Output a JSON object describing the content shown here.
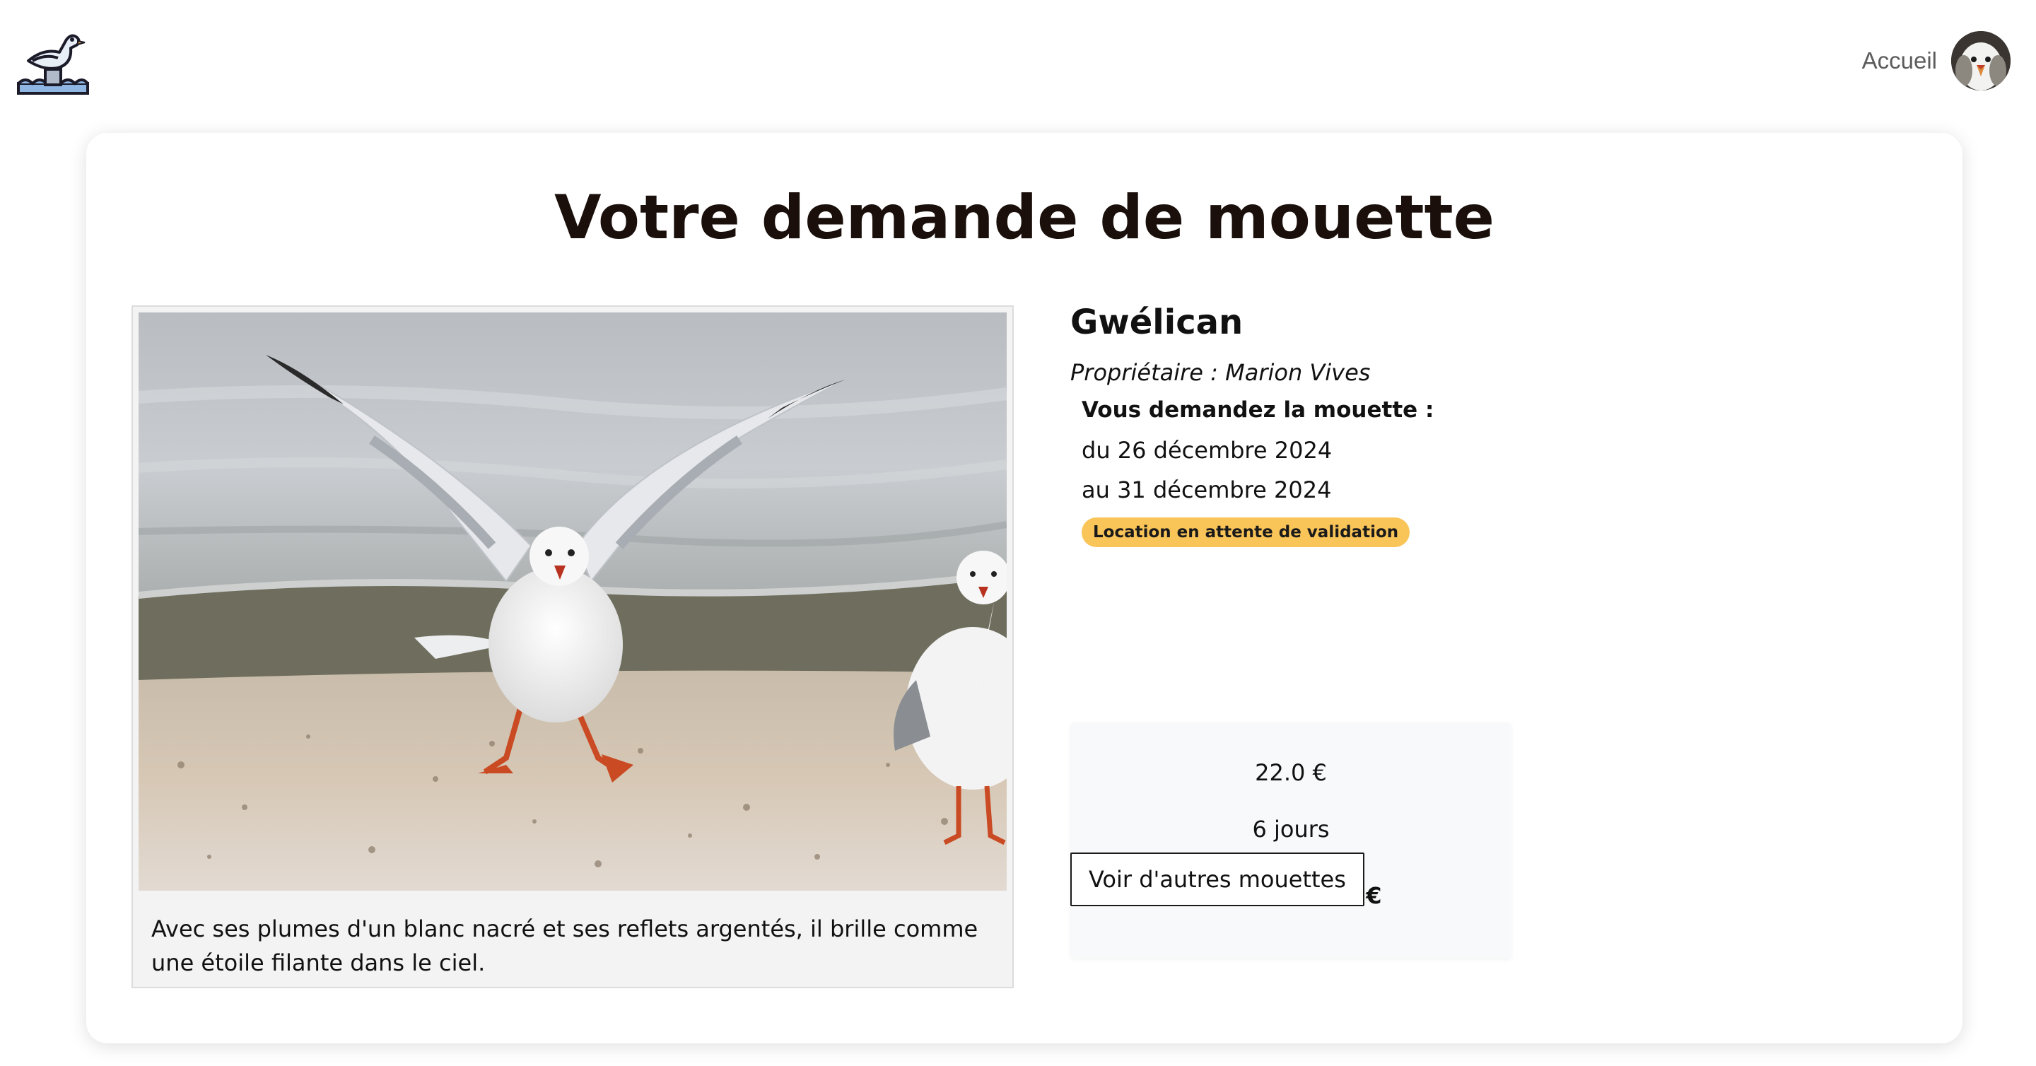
{
  "nav": {
    "logo_icon": "seagull-on-buoy-icon",
    "home_label": "Accueil",
    "avatar_icon": "user-avatar-seagull"
  },
  "page": {
    "title": "Votre demande de mouette"
  },
  "gull": {
    "photo_icon": "seagull-photo",
    "description": "Avec ses plumes d'un blanc nacré et ses reflets argentés, il brille comme une étoile filante dans le ciel.",
    "name": "Gwélican",
    "owner_prefix": "Propriétaire : ",
    "owner_name": "Marion Vives"
  },
  "request": {
    "label": "Vous demandez la mouette :",
    "from": "du 26 décembre 2024",
    "to": "au 31 décembre 2024",
    "status": "Location en attente de validation",
    "status_color": "#f9c458"
  },
  "price": {
    "daily": "22.0 €",
    "days": "6 jours",
    "total": "Total : 132.0 €"
  },
  "actions": {
    "more_label": "Voir d'autres mouettes"
  }
}
